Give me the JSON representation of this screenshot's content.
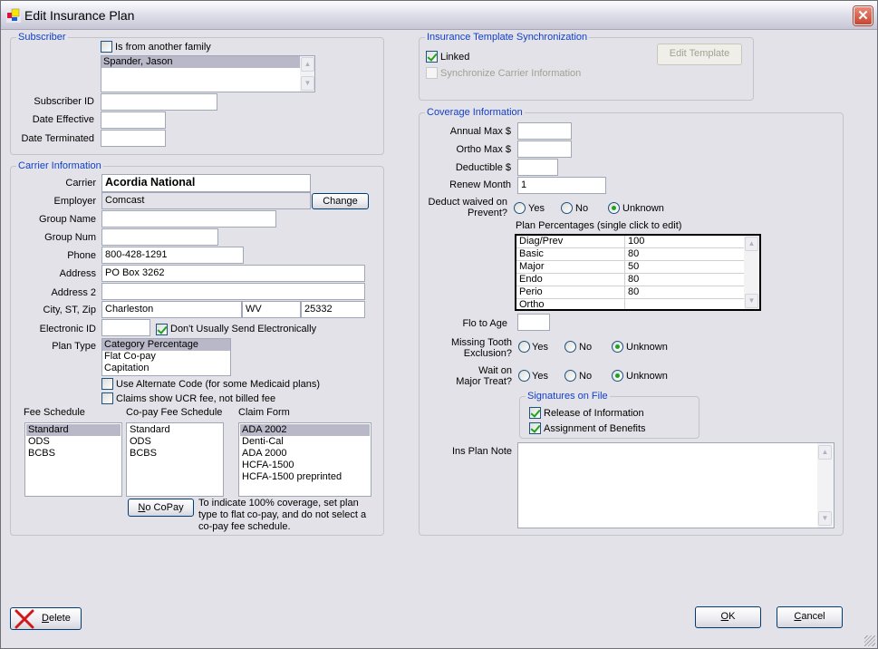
{
  "window": {
    "title": "Edit Insurance Plan",
    "close_glyph": "✕"
  },
  "subscriber": {
    "group_title": "Subscriber",
    "other_family_label": "Is from another family",
    "other_family_checked": false,
    "subscriber_list": [
      "Spander, Jason"
    ],
    "subscriber_id_label": "Subscriber ID",
    "subscriber_id": "",
    "date_effective_label": "Date Effective",
    "date_effective": "",
    "date_terminated_label": "Date Terminated",
    "date_terminated": ""
  },
  "carrier": {
    "group_title": "Carrier Information",
    "carrier_label": "Carrier",
    "carrier": "Acordia National",
    "employer_label": "Employer",
    "employer": "Comcast",
    "change_button": "Change",
    "group_name_label": "Group Name",
    "group_name": "",
    "group_num_label": "Group Num",
    "group_num": "",
    "phone_label": "Phone",
    "phone": "800-428-1291",
    "address_label": "Address",
    "address": "PO Box 3262",
    "address2_label": "Address 2",
    "address2": "",
    "city_st_zip_label": "City, ST, Zip",
    "city": "Charleston",
    "state": "WV",
    "zip": "25332",
    "electronic_id_label": "Electronic ID",
    "electronic_id": "",
    "dont_send_label": "Don't Usually Send Electronically",
    "dont_send_checked": true,
    "plan_type_label": "Plan Type",
    "plan_types": [
      "Category Percentage",
      "Flat Co-pay",
      "Capitation"
    ],
    "plan_type_selected": "Category Percentage",
    "alt_code_label": "Use Alternate Code (for some Medicaid plans)",
    "alt_code_checked": false,
    "ucr_label": "Claims show UCR fee, not billed fee",
    "ucr_checked": false,
    "fee_schedule_label": "Fee Schedule",
    "fee_schedules": [
      "Standard",
      "ODS",
      "BCBS"
    ],
    "fee_schedule_selected": "Standard",
    "copay_schedule_label": "Co-pay Fee Schedule",
    "copay_schedules": [
      "Standard",
      "ODS",
      "BCBS"
    ],
    "claim_form_label": "Claim Form",
    "claim_forms": [
      "ADA 2002",
      "Denti-Cal",
      "ADA 2000",
      "HCFA-1500",
      "HCFA-1500 preprinted"
    ],
    "claim_form_selected": "ADA 2002",
    "no_copay_button_mnemonic": "N",
    "no_copay_button_rest": "o CoPay",
    "no_copay_note": "To indicate 100% coverage, set plan type to flat co-pay, and do not select a co-pay fee schedule."
  },
  "template_sync": {
    "group_title": "Insurance Template Synchronization",
    "linked_label": "Linked",
    "linked_checked": true,
    "sync_carrier_label": "Synchronize Carrier Information",
    "sync_carrier_checked": false,
    "edit_template_button": "Edit Template"
  },
  "coverage": {
    "group_title": "Coverage Information",
    "annual_max_label": "Annual Max $",
    "annual_max": "",
    "ortho_max_label": "Ortho Max $",
    "ortho_max": "",
    "deductible_label": "Deductible $",
    "deductible": "",
    "renew_month_label": "Renew Month",
    "renew_month": "1",
    "deduct_waived_label_1": "Deduct waived on",
    "deduct_waived_label_2": "Prevent?",
    "radio_yes": "Yes",
    "radio_no": "No",
    "radio_unknown": "Unknown",
    "deduct_waived_value": "Unknown",
    "plan_percentages_label": "Plan Percentages (single click to edit)",
    "plan_percentages": [
      {
        "category": "Diag/Prev",
        "percent": "100"
      },
      {
        "category": "Basic",
        "percent": "80"
      },
      {
        "category": "Major",
        "percent": "50"
      },
      {
        "category": "Endo",
        "percent": "80"
      },
      {
        "category": "Perio",
        "percent": "80"
      },
      {
        "category": "Ortho",
        "percent": ""
      }
    ],
    "flo_to_age_label": "Flo to Age",
    "flo_to_age": "",
    "missing_tooth_label_1": "Missing Tooth",
    "missing_tooth_label_2": "Exclusion?",
    "missing_tooth_value": "Unknown",
    "wait_major_label_1": "Wait on",
    "wait_major_label_2": "Major Treat?",
    "wait_major_value": "Unknown",
    "signatures_title": "Signatures on File",
    "release_info_label": "Release of Information",
    "release_info_checked": true,
    "assignment_label": "Assignment of Benefits",
    "assignment_checked": true,
    "ins_plan_note_label": "Ins Plan Note",
    "ins_plan_note": ""
  },
  "footer": {
    "delete_mnemonic": "D",
    "delete_rest": "elete",
    "ok_mnemonic": "O",
    "ok_rest": "K",
    "cancel_mnemonic": "C",
    "cancel_rest": "ancel"
  }
}
